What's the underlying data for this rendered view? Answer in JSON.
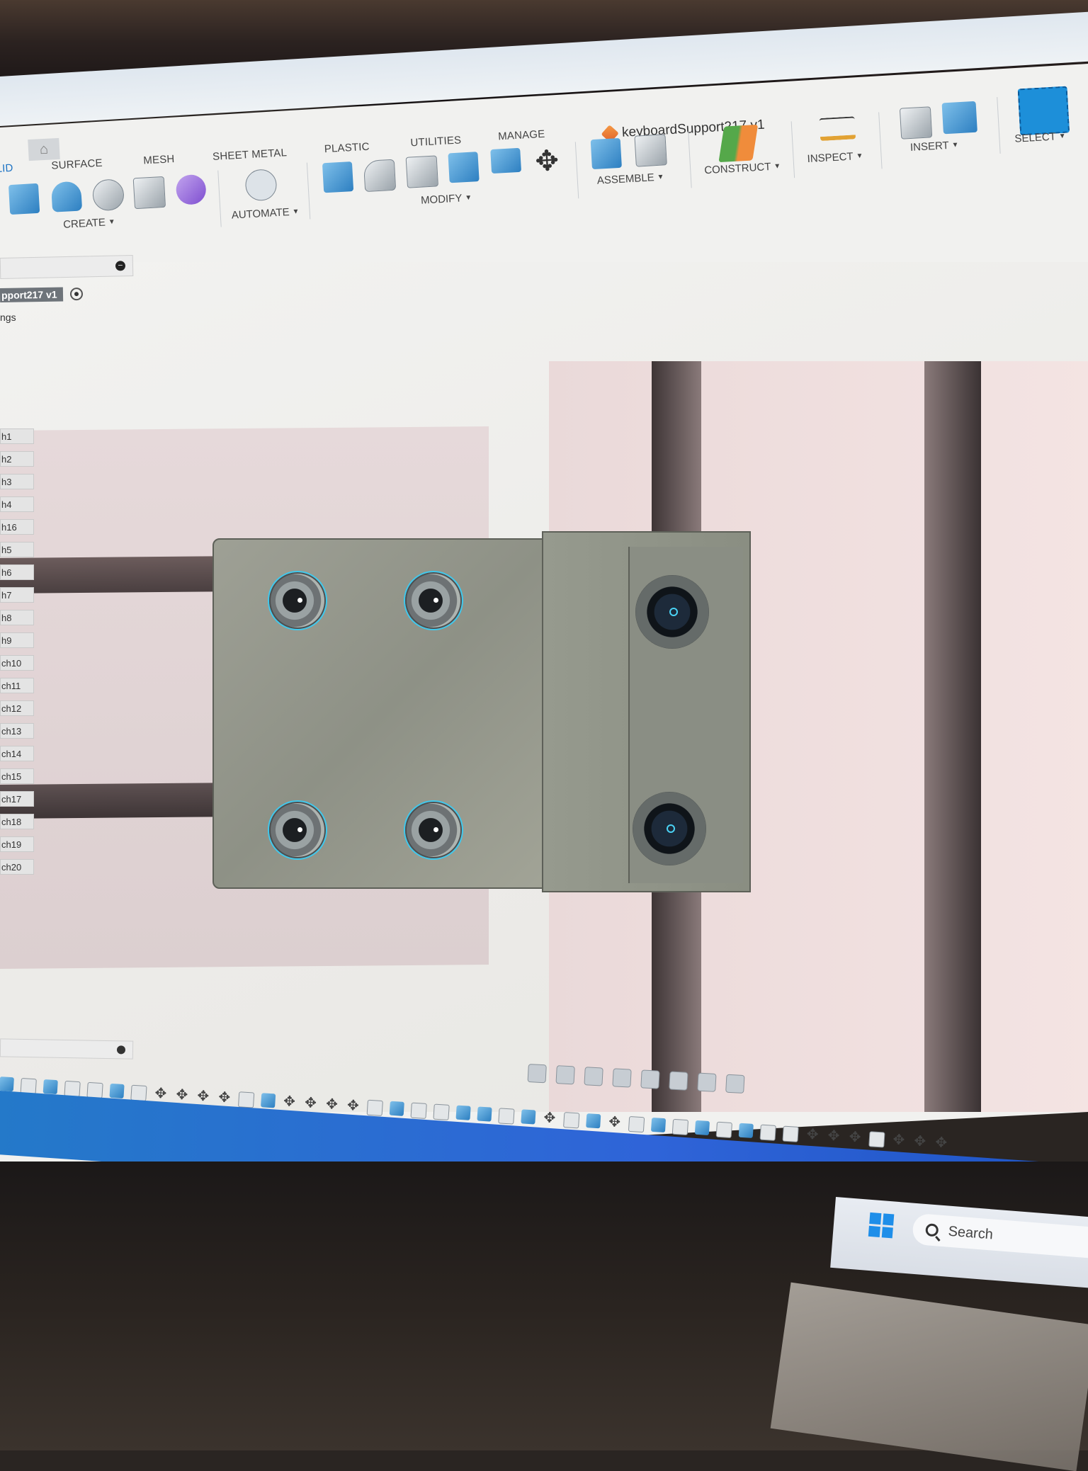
{
  "document": {
    "title": "keyboardSupport217 v1"
  },
  "toolbar": {
    "tabs": [
      "LID",
      "SURFACE",
      "MESH",
      "SHEET METAL",
      "PLASTIC",
      "UTILITIES",
      "MANAGE"
    ],
    "groups": {
      "create": "CREATE",
      "automate": "AUTOMATE",
      "modify": "MODIFY",
      "assemble": "ASSEMBLE",
      "construct": "CONSTRUCT",
      "inspect": "INSPECT",
      "insert": "INSERT",
      "select": "SELECT"
    }
  },
  "browser": {
    "root": "pport217 v1",
    "settings": "ngs",
    "sketches": [
      "h1",
      "h2",
      "h3",
      "h4",
      "h16",
      "h5",
      "h6",
      "h7",
      "h8",
      "h9",
      "ch10",
      "ch11",
      "ch12",
      "ch13",
      "ch14",
      "ch15",
      "ch17",
      "ch18",
      "ch19",
      "ch20"
    ]
  },
  "taskbar": {
    "search": "Search"
  },
  "colors": {
    "accent": "#1b72c4",
    "selection": "#3ec9ee",
    "taskbar_blue": "#2f64d8"
  }
}
